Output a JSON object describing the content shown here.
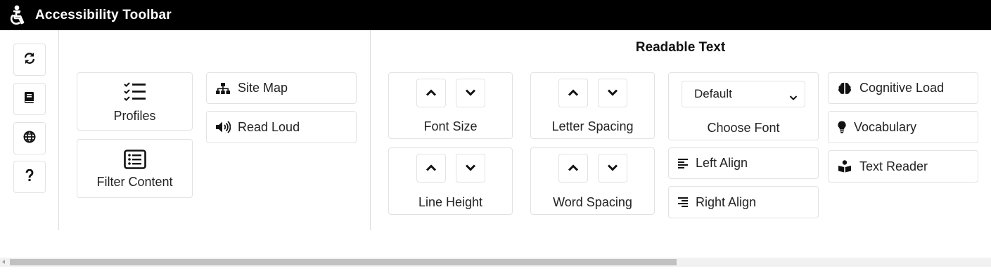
{
  "header": {
    "title": "Accessibility Toolbar",
    "logo_icon": "accessibility-wheelchair-icon"
  },
  "rail": [
    {
      "name": "reset",
      "icon": "sync-icon"
    },
    {
      "name": "dictionary",
      "icon": "book-icon"
    },
    {
      "name": "language",
      "icon": "globe-icon"
    },
    {
      "name": "help",
      "icon": "question-icon"
    }
  ],
  "general": {
    "profiles": "Profiles",
    "filter_content": "Filter Content",
    "site_map": "Site Map",
    "read_loud": "Read Loud"
  },
  "readable_text": {
    "title": "Readable Text",
    "font_size": "Font Size",
    "letter_spacing": "Letter Spacing",
    "line_height": "Line Height",
    "word_spacing": "Word Spacing",
    "font_select_value": "Default",
    "choose_font": "Choose Font",
    "left_align": "Left Align",
    "right_align": "Right Align",
    "cognitive_load": "Cognitive Load",
    "vocabulary": "Vocabulary",
    "text_reader": "Text Reader"
  },
  "scrollbar": {
    "position": 0.0,
    "visible_fraction": 0.67
  }
}
